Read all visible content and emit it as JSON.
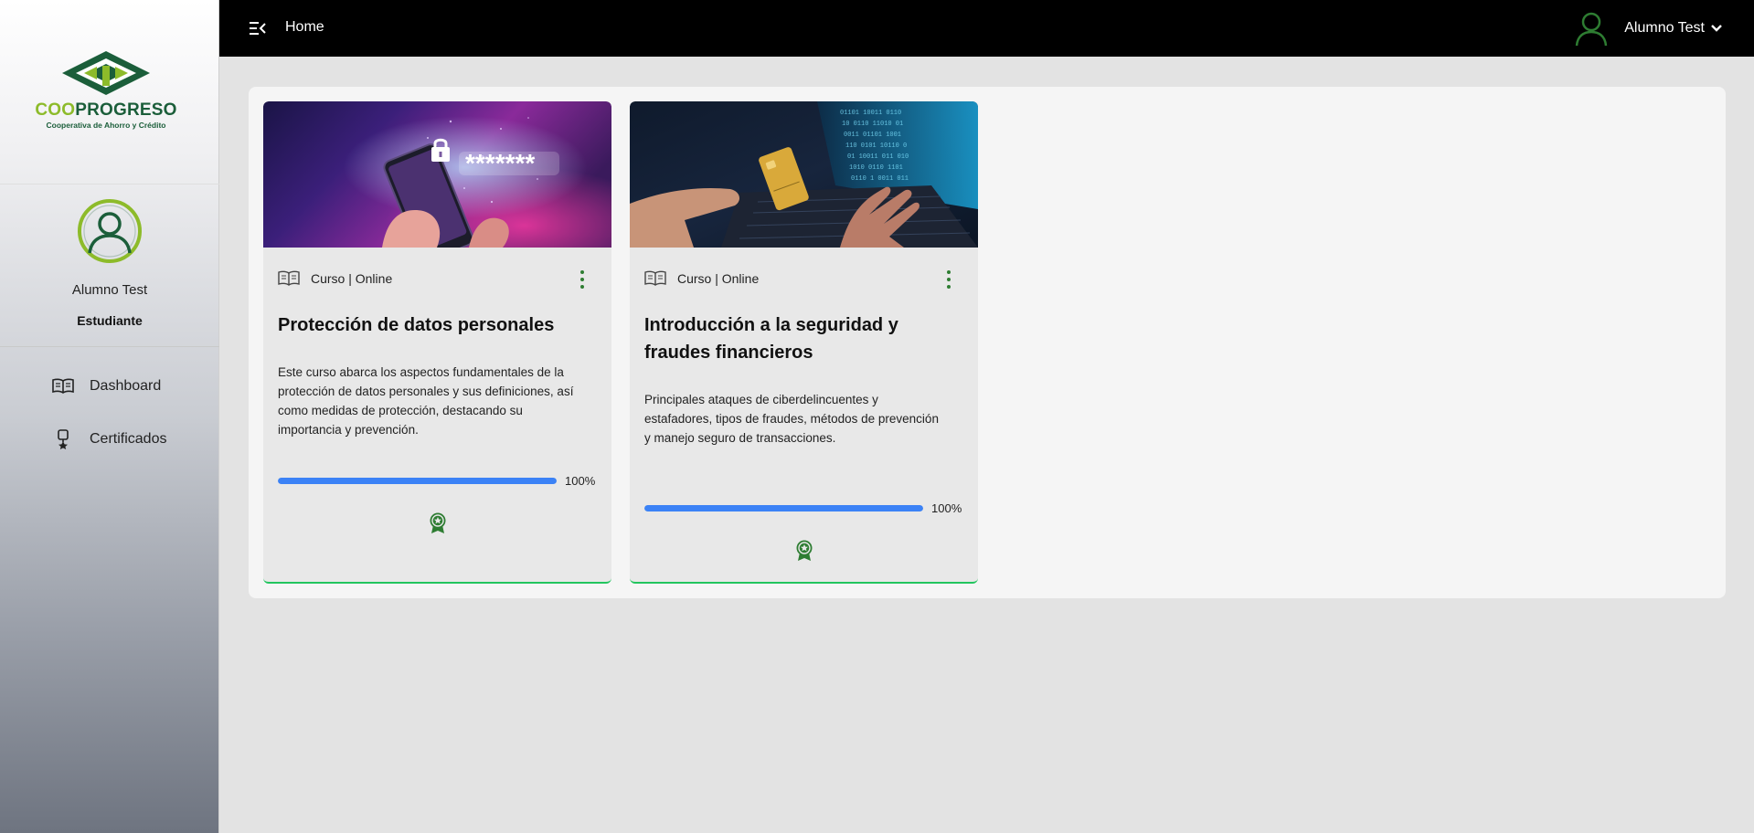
{
  "brand": {
    "name_part1": "COO",
    "name_part2": "PROGRESO",
    "subtitle": "Cooperativa de Ahorro y Crédito",
    "colors": {
      "dark_green": "#1b5e3a",
      "light_green": "#8dbb2a"
    }
  },
  "topbar": {
    "title": "Home",
    "menu_icon": "menu-collapse-icon"
  },
  "user": {
    "name": "Alumno Test",
    "role": "Estudiante"
  },
  "sidebar": {
    "items": [
      {
        "label": "Dashboard",
        "icon": "book-open-icon"
      },
      {
        "label": "Certificados",
        "icon": "award-ribbon-icon"
      }
    ]
  },
  "courses": [
    {
      "type": "Curso | Online",
      "title": "Protección de datos personales",
      "description": "Este curso abarca los aspectos fundamentales de la protección de datos personales y sus definiciones, así como medidas de protección, destacando su importancia y prevención.",
      "progress": 100,
      "progress_label": "100%",
      "image_text": "*******"
    },
    {
      "type": "Curso | Online",
      "title": "Introducción a la seguridad y fraudes financieros",
      "description": "Principales ataques de ciberdelincuentes y estafadores, tipos de fraudes, métodos de prevención y manejo seguro de transacciones.",
      "progress": 100,
      "progress_label": "100%"
    }
  ],
  "colors": {
    "accent_progress": "#3b82f6",
    "card_border": "#22c55e",
    "icon_green": "#2e7d32"
  }
}
